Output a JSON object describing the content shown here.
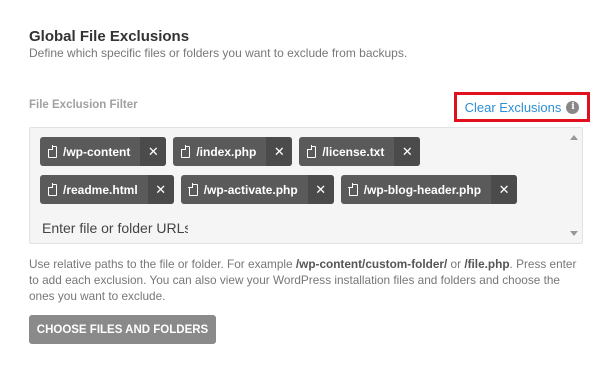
{
  "section": {
    "title": "Global File Exclusions",
    "description": "Define which specific files or folders you want to exclude from backups."
  },
  "filter": {
    "label": "File Exclusion Filter",
    "clear_label": "Clear Exclusions",
    "info_glyph": "i",
    "tags": [
      {
        "label": "/wp-content",
        "icon": "file-icon",
        "remove": "✕"
      },
      {
        "label": "/index.php",
        "icon": "file-icon",
        "remove": "✕"
      },
      {
        "label": "/license.txt",
        "icon": "file-icon",
        "remove": "✕"
      },
      {
        "label": "/readme.html",
        "icon": "file-icon",
        "remove": "✕"
      },
      {
        "label": "/wp-activate.php",
        "icon": "file-icon",
        "remove": "✕"
      },
      {
        "label": "/wp-blog-header.php",
        "icon": "file-icon",
        "remove": "✕"
      }
    ],
    "input_placeholder": "Enter file or folder URLs",
    "input_value": ""
  },
  "help": {
    "part1": "Use relative paths to the file or folder. For example ",
    "example1": "/wp-content/custom-folder/",
    "part2": " or ",
    "example2": "/file.php",
    "part3": ". Press enter to add each exclusion. You can also view your WordPress installation files and folders and choose the ones you want to exclude."
  },
  "actions": {
    "choose_label": "CHOOSE FILES AND FOLDERS"
  },
  "colors": {
    "accent": "#2d8fd4",
    "highlight": "#e0111c",
    "tag_bg": "#5a5a5a",
    "button_bg": "#8a8a8a"
  }
}
